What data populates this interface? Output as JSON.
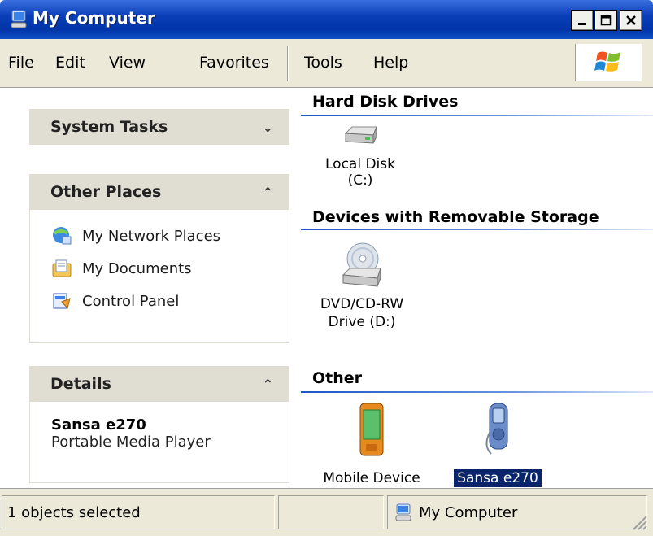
{
  "window": {
    "title": "My Computer",
    "icon": "my-computer-icon"
  },
  "menu": {
    "items": [
      {
        "label": "File"
      },
      {
        "label": "Edit"
      },
      {
        "label": "View"
      },
      {
        "label": "Favorites"
      },
      {
        "label": "Tools"
      },
      {
        "label": "Help"
      }
    ]
  },
  "tasks": {
    "system_tasks": {
      "title": "System Tasks",
      "state": "collapsed"
    },
    "other_places": {
      "title": "Other Places",
      "state": "expanded",
      "items": [
        {
          "label": "My Network Places",
          "icon": "network-places-icon"
        },
        {
          "label": "My Documents",
          "icon": "documents-folder-icon"
        },
        {
          "label": "Control Panel",
          "icon": "control-panel-icon"
        }
      ]
    },
    "details": {
      "title": "Details",
      "state": "expanded",
      "name": "Sansa e270",
      "type": "Portable Media Player"
    }
  },
  "groups": {
    "hard_disk": {
      "title": "Hard Disk Drives",
      "items": [
        {
          "label": "Local Disk (C:)",
          "icon": "hard-disk-icon"
        }
      ]
    },
    "removable": {
      "title": "Devices with Removable Storage",
      "items": [
        {
          "label_line1": "DVD/CD-RW",
          "label_line2": "Drive (D:)",
          "icon": "dvd-drive-icon"
        }
      ]
    },
    "other": {
      "title": "Other",
      "items": [
        {
          "label": "Mobile Device",
          "icon": "mobile-device-icon"
        },
        {
          "label": "Sansa e270",
          "icon": "media-player-icon",
          "selected": true
        }
      ]
    }
  },
  "status": {
    "selection": "1 objects selected",
    "location": "My Computer"
  },
  "colors": {
    "titlebar": "#0a3fb8",
    "selection": "#0a246a",
    "panel_header": "#e0ded3"
  }
}
